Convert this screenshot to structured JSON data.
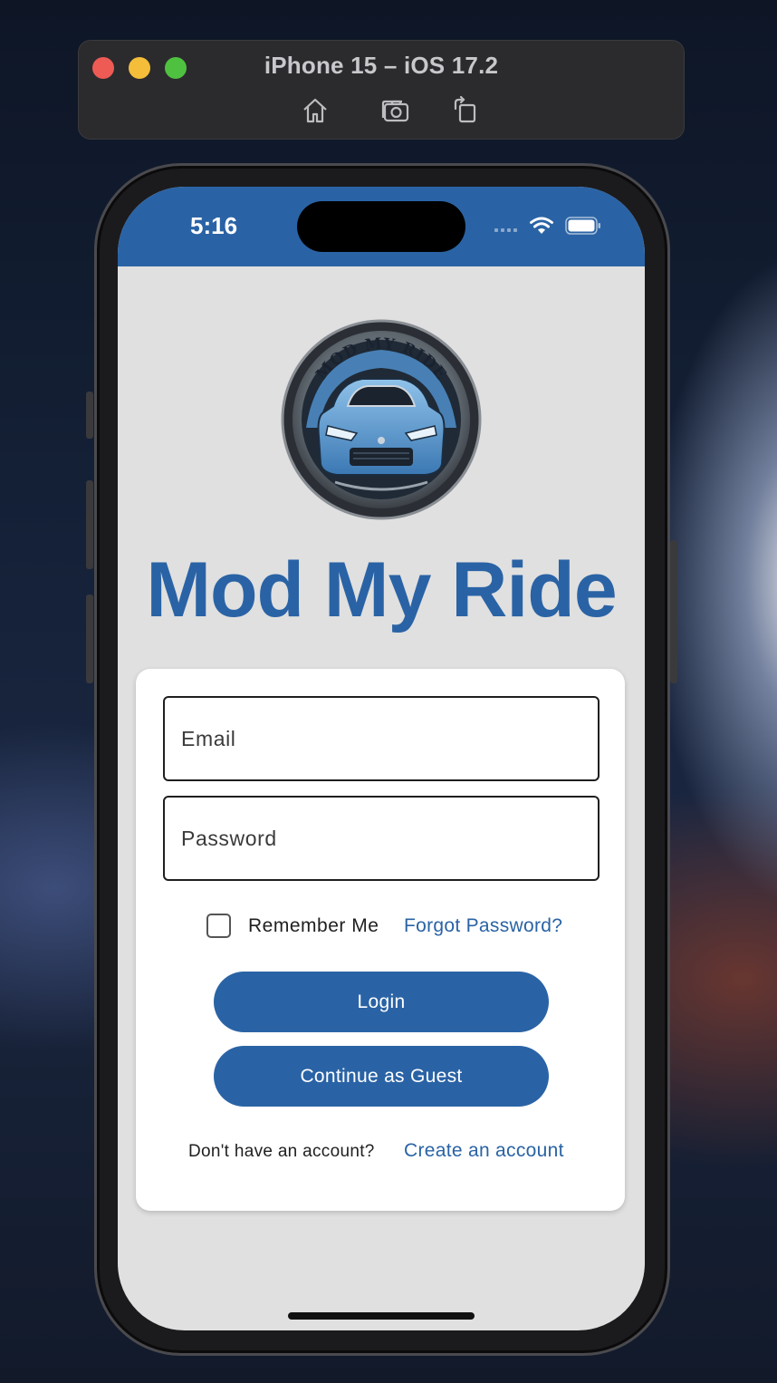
{
  "simulator": {
    "title": "iPhone 15 – iOS 17.2",
    "buttons": [
      "home-icon",
      "screenshot-icon",
      "rotate-icon"
    ]
  },
  "status_bar": {
    "time": "5:16",
    "color": "#2a63a5"
  },
  "app": {
    "logo_text": "MOD MY RIDE",
    "title": "Mod My Ride",
    "accent_color": "#2a63a5"
  },
  "login_form": {
    "email_placeholder": "Email",
    "password_placeholder": "Password",
    "remember_me_label": "Remember Me",
    "remember_me_checked": false,
    "forgot_password_label": "Forgot Password?",
    "login_label": "Login",
    "guest_label": "Continue as Guest",
    "no_account_text": "Don't have an account?",
    "create_account_label": "Create an account"
  }
}
